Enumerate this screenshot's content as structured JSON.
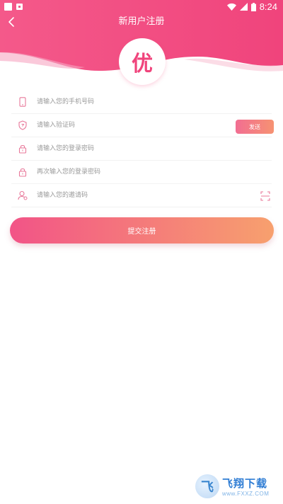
{
  "status_bar": {
    "time": "8:24"
  },
  "header": {
    "title": "新用户注册",
    "logo_text": "优",
    "back_icon": "back-arrow-icon"
  },
  "form": {
    "phone": {
      "placeholder": "请输入您的手机号码",
      "icon": "phone-icon"
    },
    "code": {
      "placeholder": "请输入验证码",
      "icon": "shield-icon",
      "send_label": "发送"
    },
    "password": {
      "placeholder": "请输入您的登录密码",
      "icon": "lock-icon"
    },
    "password_confirm": {
      "placeholder": "再次输入您的登录密码",
      "icon": "lock-icon"
    },
    "invite": {
      "placeholder": "请输入您的邀请码",
      "icon": "user-icon",
      "scan_icon": "scan-icon"
    }
  },
  "submit_label": "提交注册",
  "watermark": {
    "title": "飞翔下载",
    "url": "www.FXXZ.COM",
    "logo_char": "飞"
  },
  "colors": {
    "primary": "#f0447c",
    "gradient_start": "#f25487",
    "gradient_end": "#f7a06e",
    "icon": "#e8789a"
  }
}
